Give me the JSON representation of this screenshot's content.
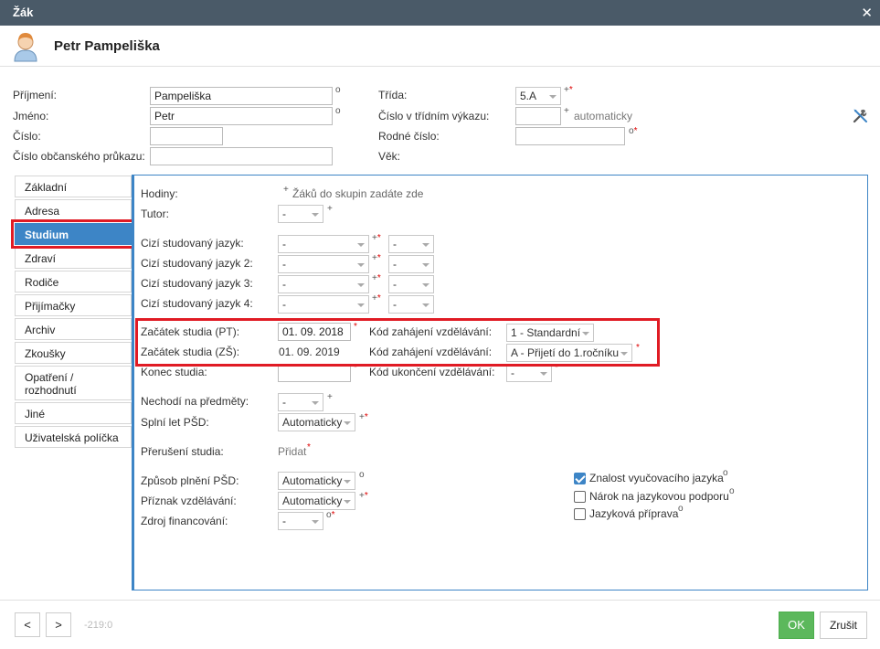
{
  "window": {
    "title": "Žák",
    "close_icon": "close-icon"
  },
  "student": {
    "name": "Petr Pampeliška",
    "avatar_icon": "student-avatar-icon"
  },
  "header_form": {
    "surname": {
      "label": "Příjmení:",
      "value": "Pampeliška",
      "mark": "o"
    },
    "firstname": {
      "label": "Jméno:",
      "value": "Petr",
      "mark": "o"
    },
    "number": {
      "label": "Číslo:",
      "value": ""
    },
    "id_card": {
      "label": "Číslo občanského průkazu:",
      "value": ""
    },
    "class": {
      "label": "Třída:",
      "value": "5.A",
      "mark": "+",
      "req": "*"
    },
    "class_report_number": {
      "label": "Číslo v třídním výkazu:",
      "value": "",
      "mark": "+",
      "hint": "automaticky"
    },
    "birth_number": {
      "label": "Rodné číslo:",
      "value": "",
      "mark": "o",
      "req": "*"
    },
    "age": {
      "label": "Věk:"
    },
    "tools_icon": "tools-icon"
  },
  "tabs": [
    {
      "label": "Základní",
      "active": false
    },
    {
      "label": "Adresa",
      "active": false
    },
    {
      "label": "Studium",
      "active": true
    },
    {
      "label": "Zdraví",
      "active": false
    },
    {
      "label": "Rodiče",
      "active": false
    },
    {
      "label": "Přijímačky",
      "active": false
    },
    {
      "label": "Archiv",
      "active": false
    },
    {
      "label": "Zkoušky",
      "active": false
    },
    {
      "label": "Opatření / rozhodnutí",
      "active": false
    },
    {
      "label": "Jiné",
      "active": false
    },
    {
      "label": "Uživatelská políčka",
      "active": false
    }
  ],
  "study": {
    "hours": {
      "label": "Hodiny:",
      "mark": "+",
      "note": "Žáků do skupin zadáte zde"
    },
    "tutor": {
      "label": "Tutor:",
      "value": "-",
      "mark": "+"
    },
    "languages": [
      {
        "label": "Cizí studovaný jazyk:",
        "value": "-",
        "level": "-",
        "mark": "+",
        "req": "*"
      },
      {
        "label": "Cizí studovaný jazyk 2:",
        "value": "-",
        "level": "-",
        "mark": "+",
        "req": "*"
      },
      {
        "label": "Cizí studovaný jazyk 3:",
        "value": "-",
        "level": "-",
        "mark": "+",
        "req": "*"
      },
      {
        "label": "Cizí studovaný jazyk 4:",
        "value": "-",
        "level": "-",
        "mark": "+",
        "req": "*"
      }
    ],
    "start_pt": {
      "label": "Začátek studia (PT):",
      "value": "01. 09. 2018",
      "req": "*"
    },
    "start_code_pt": {
      "label": "Kód zahájení vzdělávání:",
      "value": "1 - Standardní"
    },
    "start_zs": {
      "label": "Začátek studia (ZŠ):",
      "value": "01. 09. 2019"
    },
    "start_code_zs": {
      "label": "Kód zahájení vzdělávání:",
      "value": "A - Přijetí do 1.ročníku",
      "req": "*"
    },
    "end": {
      "label": "Konec studia:",
      "value": "",
      "req": "*"
    },
    "end_code": {
      "label": "Kód ukončení vzdělávání:",
      "value": "-",
      "req": "*"
    },
    "not_attending": {
      "label": "Nechodí na předměty:",
      "value": "-",
      "mark": "+"
    },
    "psd_years": {
      "label": "Splní let PŠD:",
      "value": "Automaticky",
      "mark": "+",
      "req": "*"
    },
    "interruption": {
      "label": "Přerušení studia:",
      "link": "Přidat",
      "req": "*"
    },
    "psd_mode": {
      "label": "Způsob plnění PŠD:",
      "value": "Automaticky",
      "mark": "o"
    },
    "edu_flag": {
      "label": "Příznak vzdělávání:",
      "value": "Automaticky",
      "mark": "+",
      "req": "*"
    },
    "funding": {
      "label": "Zdroj financování:",
      "value": "-",
      "mark": "o",
      "req": "*"
    },
    "checkboxes": [
      {
        "label": "Znalost vyučovacího jazyka",
        "checked": true,
        "mark": "o"
      },
      {
        "label": "Nárok na jazykovou podporu",
        "checked": false,
        "mark": "o"
      },
      {
        "label": "Jazyková příprava",
        "checked": false,
        "mark": "o"
      }
    ]
  },
  "footer": {
    "prev_label": "<",
    "next_label": ">",
    "record_id": "-219:0",
    "ok_label": "OK",
    "cancel_label": "Zrušit"
  },
  "colors": {
    "accent": "#3d85c6",
    "highlight": "#e01b24",
    "ok": "#5cb85c",
    "titlebar": "#4a5a68",
    "required": "#dd0000"
  }
}
